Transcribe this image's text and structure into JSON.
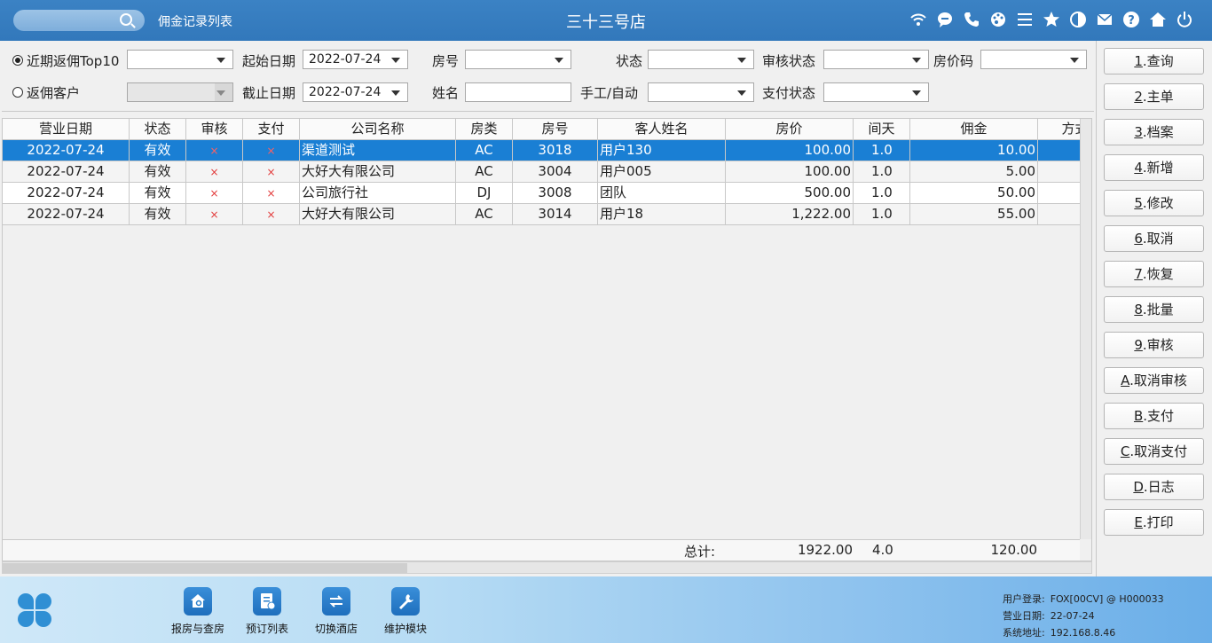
{
  "topbar": {
    "module_title": "佣金记录列表",
    "store_name": "三十三号店",
    "icons": [
      "wifi-icon",
      "chat-icon",
      "phone-icon",
      "palette-icon",
      "menu-icon",
      "star-icon",
      "contrast-icon",
      "mail-icon",
      "help-icon",
      "home-icon",
      "power-icon"
    ]
  },
  "filters": {
    "recent_top10_label": "近期返佣Top10",
    "rebate_customer_label": "返佣客户",
    "start_date_label": "起始日期",
    "start_date": "2022-07-24",
    "end_date_label": "截止日期",
    "end_date": "2022-07-24",
    "room_no_label": "房号",
    "name_label": "姓名",
    "status_label": "状态",
    "manual_auto_label": "手工/自动",
    "audit_status_label": "审核状态",
    "pay_status_label": "支付状态",
    "room_price_code_label": "房价码"
  },
  "grid": {
    "columns": [
      "营业日期",
      "状态",
      "审核",
      "支付",
      "公司名称",
      "房类",
      "房号",
      "客人姓名",
      "房价",
      "间天",
      "佣金",
      "方式"
    ],
    "rows": [
      [
        "2022-07-24",
        "有效",
        "×",
        "×",
        "渠道测试",
        "AC",
        "3018",
        "用户130",
        "100.00",
        "1.0",
        "10.00",
        ""
      ],
      [
        "2022-07-24",
        "有效",
        "×",
        "×",
        "大好大有限公司",
        "AC",
        "3004",
        "用户005",
        "100.00",
        "1.0",
        "5.00",
        ""
      ],
      [
        "2022-07-24",
        "有效",
        "×",
        "×",
        "公司旅行社",
        "DJ",
        "3008",
        "团队",
        "500.00",
        "1.0",
        "50.00",
        ""
      ],
      [
        "2022-07-24",
        "有效",
        "×",
        "×",
        "大好大有限公司",
        "AC",
        "3014",
        "用户18",
        "1,222.00",
        "1.0",
        "55.00",
        ""
      ]
    ],
    "selected_row": 0,
    "total_label": "总计:",
    "total_price": "1922.00",
    "total_nights": "4.0",
    "total_commission": "120.00"
  },
  "buttons": [
    {
      "key": "1",
      "label": ".查询"
    },
    {
      "key": "2",
      "label": ".主单"
    },
    {
      "key": "3",
      "label": ".档案"
    },
    {
      "key": "4",
      "label": ".新增"
    },
    {
      "key": "5",
      "label": ".修改"
    },
    {
      "key": "6",
      "label": ".取消"
    },
    {
      "key": "7",
      "label": ".恢复"
    },
    {
      "key": "8",
      "label": ".批量"
    },
    {
      "key": "9",
      "label": ".审核"
    },
    {
      "key": "A",
      "label": ".取消审核"
    },
    {
      "key": "B",
      "label": ".支付"
    },
    {
      "key": "C",
      "label": ".取消支付"
    },
    {
      "key": "D",
      "label": ".日志"
    },
    {
      "key": "E",
      "label": ".打印"
    }
  ],
  "bottombar": {
    "nav": [
      {
        "label": "报房与查房",
        "icon": "house-search-icon"
      },
      {
        "label": "预订列表",
        "icon": "booking-list-icon"
      },
      {
        "label": "切换酒店",
        "icon": "switch-icon"
      },
      {
        "label": "维护模块",
        "icon": "wrench-icon"
      }
    ],
    "status": {
      "user_label": "用户登录:",
      "user_value": "FOX[00CV] @ H000033",
      "bizdate_label": "营业日期:",
      "bizdate_value": "22-07-24",
      "address_label": "系统地址:",
      "address_value": "192.168.8.46"
    }
  }
}
